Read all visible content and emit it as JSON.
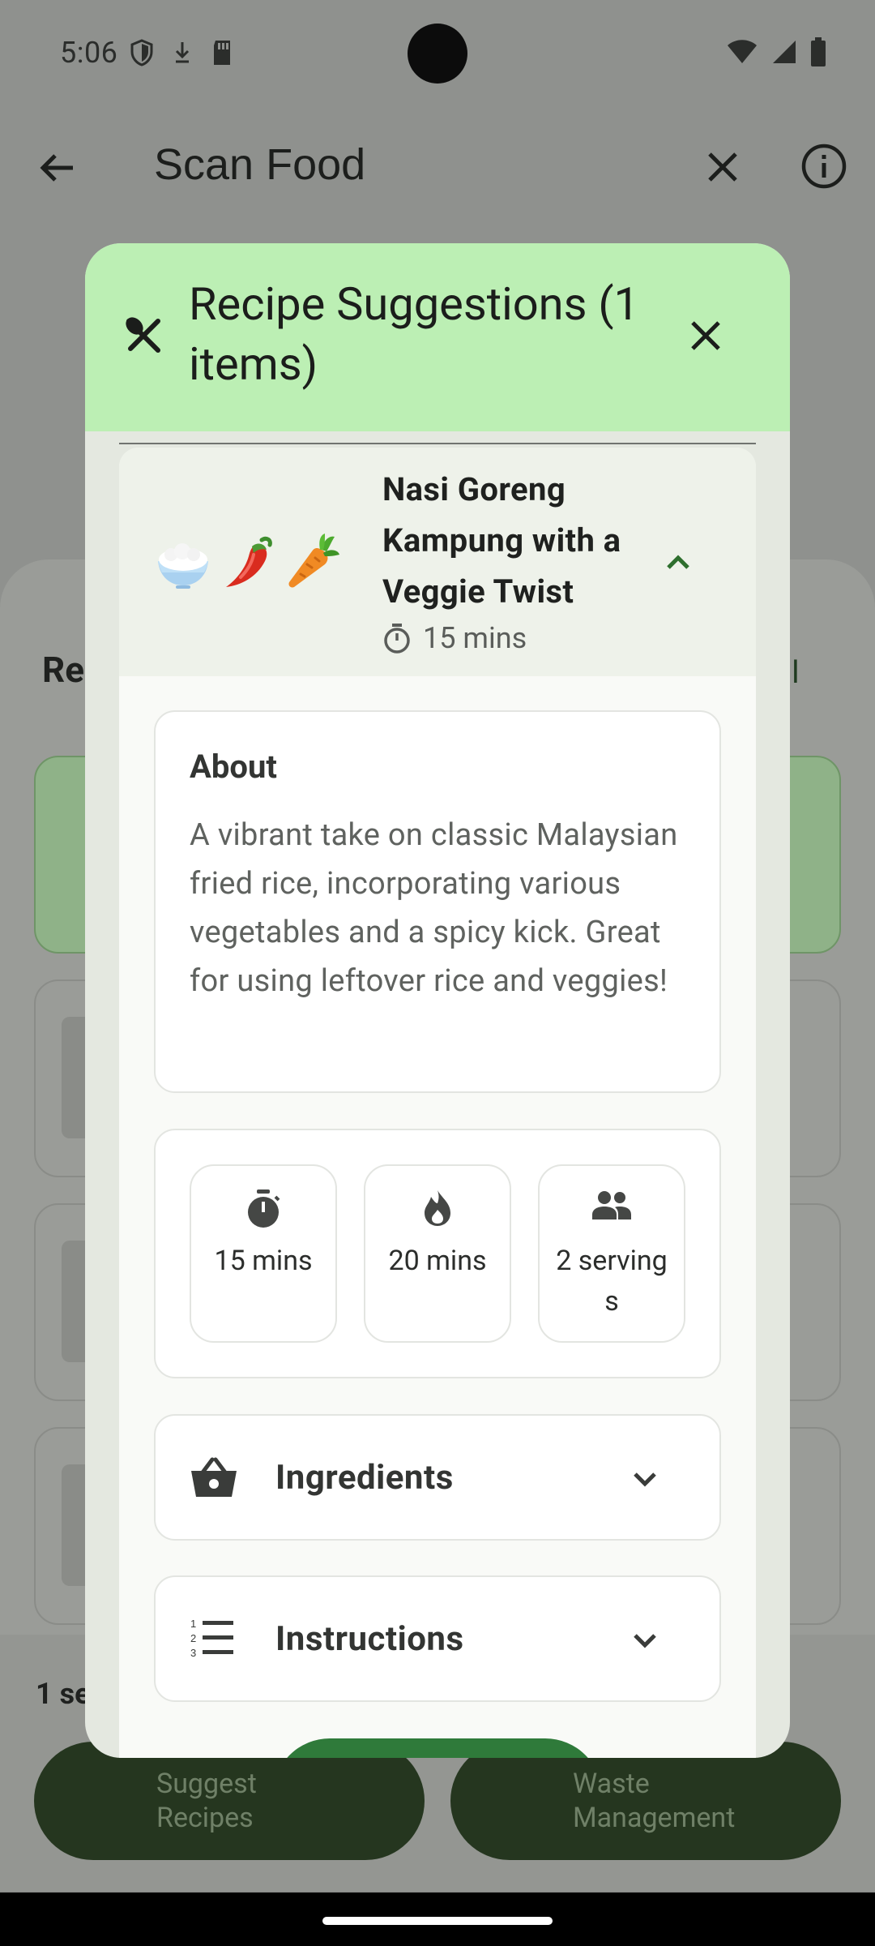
{
  "status_bar": {
    "time": "5:06"
  },
  "app_bar": {
    "title": "Scan Food"
  },
  "background": {
    "heading": "Re",
    "link": "ll",
    "selected_count": "1 se",
    "buttons": {
      "suggest": "Suggest Recipes",
      "waste": "Waste Management"
    }
  },
  "dialog": {
    "title": "Recipe Suggestions (1 items)",
    "recipe": {
      "emojis": [
        "rice",
        "chili",
        "carrot"
      ],
      "name": "Nasi Goreng Kampung with a Veggie Twist",
      "time": "15 mins",
      "about_title": "About",
      "about_text": "A vibrant take on classic Malaysian fried rice, incorporating various vegetables and a spicy kick. Great for using leftover rice and veggies!",
      "stats": [
        {
          "icon": "timer-icon",
          "value": "15 mins"
        },
        {
          "icon": "flame-icon",
          "value": "20 mins"
        },
        {
          "icon": "people-icon",
          "value": "2 servings"
        }
      ],
      "ingredients_label": "Ingredients",
      "instructions_label": "Instructions"
    }
  },
  "colors": {
    "header_green": "#bcefb4",
    "dark_green_button": "#2f7a3a",
    "scrim": "#8f918e"
  }
}
